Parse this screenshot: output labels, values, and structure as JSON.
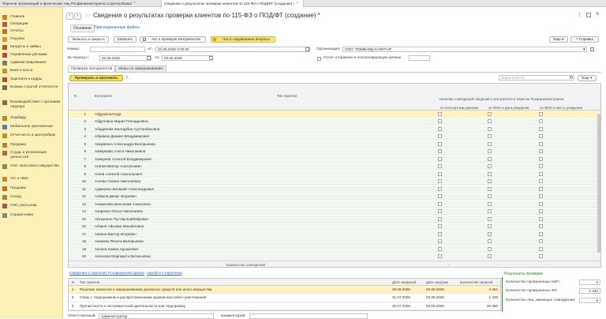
{
  "window_tabs": [
    {
      "label": "Перечни организаций и физических лиц Росфинмониторинга и Центробанка",
      "active": false
    },
    {
      "label": "Сведения о результатах проверки клиентов по 115-ФЗ о ПОД/ФТ (создание) *",
      "active": true
    }
  ],
  "sidebar": [
    "Главное",
    "Операции",
    "Отчеты",
    "Покупки",
    "Кредиты и займы",
    "Управление рисками",
    "Администрирование",
    "Банк и касса",
    "Зарплата и кадры",
    "Бланки строгой отчетности",
    "Взаимодействие с органами надзора",
    "Ломбард",
    "Мобильное приложение",
    "Отчетность в Центробанк",
    "Продажа",
    "Ссуды и реализация ценностей",
    "Учет залогового имущества",
    "ОС и НМА",
    "Продажи",
    "Склад",
    "СМС рассылка",
    "Справочники"
  ],
  "header": {
    "title": "Сведения о результатах проверки клиентов по 115-ФЗ о ПОД/ФТ (создание) *",
    "more": "⋮"
  },
  "subtabs": {
    "main": "Основное",
    "files": "Присоединенные файлы"
  },
  "toolbar": {
    "save_close": "Записать и закрыть",
    "save": "Записать",
    "act": "Акт о проверке контрагентов",
    "faq": "Часто задаваемые вопросы",
    "more": "Еще",
    "help": "Справка"
  },
  "form": {
    "number_label": "Номер:",
    "from_label": "от:",
    "from_value": "03.08.2026  0:00:00",
    "org_label": "Организация:",
    "org_value": "ООО \"ЛОМБАРД КАПИТАЛ\"",
    "period_label": "За период с:",
    "period_from": "03.08.2026",
    "period_to_label": "по:",
    "period_to": "03.08.2026",
    "report_label": "Отчет отправлен в контролирующие органы"
  },
  "section_tabs": {
    "check": "Проверка контрагентов",
    "freeze": "Меры по замораживанию"
  },
  "check_button": "Проверить и заполнить",
  "help_q": "?",
  "search_placeholder": "Поиск (Ctrl+F)",
  "search_more": "Еще",
  "grid": {
    "col_n": "N",
    "col_counterparty": "Контрагент",
    "col_type": "Тип перечня",
    "col_match_group": "Наличие совпадений сведений о контрагенте в перечне Росфинмониторинга",
    "col_passport": "по паспортным данным",
    "col_fio_dob": "по ФИО и дате рождения",
    "col_fio_place": "по ФИО и месту рождения",
    "rows": [
      {
        "n": "1",
        "name": "Абдужалилгода"
      },
      {
        "n": "2",
        "name": "Абдуллина Мария Геннадьевна"
      },
      {
        "n": "3",
        "name": "Абидинова Малгарбин Султанбековна"
      },
      {
        "n": "4",
        "name": "Абрамов Даниил Владимирович"
      },
      {
        "n": "5",
        "name": "Авериенко Александра Валерьевна"
      },
      {
        "n": "6",
        "name": "Авакумова Алеся Николаевна"
      },
      {
        "n": "7",
        "name": "Авакумов Алексей Владимирович"
      },
      {
        "n": "8",
        "name": "Агапов Виктор Анатольевич"
      },
      {
        "n": "9",
        "name": "Агеев Алексей Анатольевич"
      },
      {
        "n": "10",
        "name": "Агеева Галина Николаевна"
      },
      {
        "n": "11",
        "name": "Адаменко Валерий Александрович"
      },
      {
        "n": "12",
        "name": "Азбаков Денис Игоревич"
      },
      {
        "n": "13",
        "name": "Азаматова Шахсанам Ахматовна"
      },
      {
        "n": "14",
        "name": "Азаренко Ольга Николаевна"
      },
      {
        "n": "15",
        "name": "Айтазиное Рустам Байбабуевич"
      },
      {
        "n": "16",
        "name": "Айзина Айыжма Михайловна"
      },
      {
        "n": "17",
        "name": "Акинин Виктор Игоревич"
      },
      {
        "n": "18",
        "name": "Акимова Рената Валерьевна"
      },
      {
        "n": "19",
        "name": "Акопян Армен Аршакович"
      },
      {
        "n": "20",
        "name": "Аксенова Маргарита Витальевна"
      }
    ],
    "footer_label": "Количество совпадений",
    "footer_dash": "-"
  },
  "lists": {
    "link1": "Сведения о перечнях Росфинмониторинга",
    "sep": " - ",
    "link2": "перейти к перечням",
    "col_n": "N",
    "col_type": "Тип перечня",
    "col_date_info": "Дата сведений",
    "col_date_load": "Дата загрузки",
    "col_count": "Количество записей",
    "rows": [
      {
        "n": "1",
        "type": "Решение комиссии о замораживании денежных средств или иного имущества",
        "date_info": "25.08.2026",
        "date_load": "25.08.2026",
        "count": "3 351"
      },
      {
        "n": "2",
        "type": "Связь с терроризмом и распространением оружия массового уничтожения",
        "date_info": "31.07.2026",
        "date_load": "03.08.2026",
        "count": "1 448"
      },
      {
        "n": "3",
        "type": "Причастность к экстремистской деятельности или терроризму",
        "date_info": "30.07.2026",
        "date_load": "03.08.2026",
        "count": "26 250"
      }
    ]
  },
  "results": {
    "title": "Результаты проверки",
    "cnt_kip_label": "Количество проверенных КИП",
    "cnt_kip": "0",
    "cnt_fl_label": "Количество проверенных ФЛ",
    "cnt_fl": "1 332",
    "cnt_match_label": "Количество лиц, имеющих совпадения",
    "cnt_match": "0"
  },
  "bottom": {
    "resp_label": "Ответственный:",
    "resp_value": "Администратор",
    "comment_label": "Комментарий:",
    "comment_value": ""
  },
  "colors": {
    "sidebar": "#fbf1b7",
    "accent_yellow": "#f6e17a",
    "selected_row": "#fff3c0",
    "grid_row": "#eef6ee",
    "check_btn": "#f4dc5c",
    "link": "#2a6ab0"
  }
}
